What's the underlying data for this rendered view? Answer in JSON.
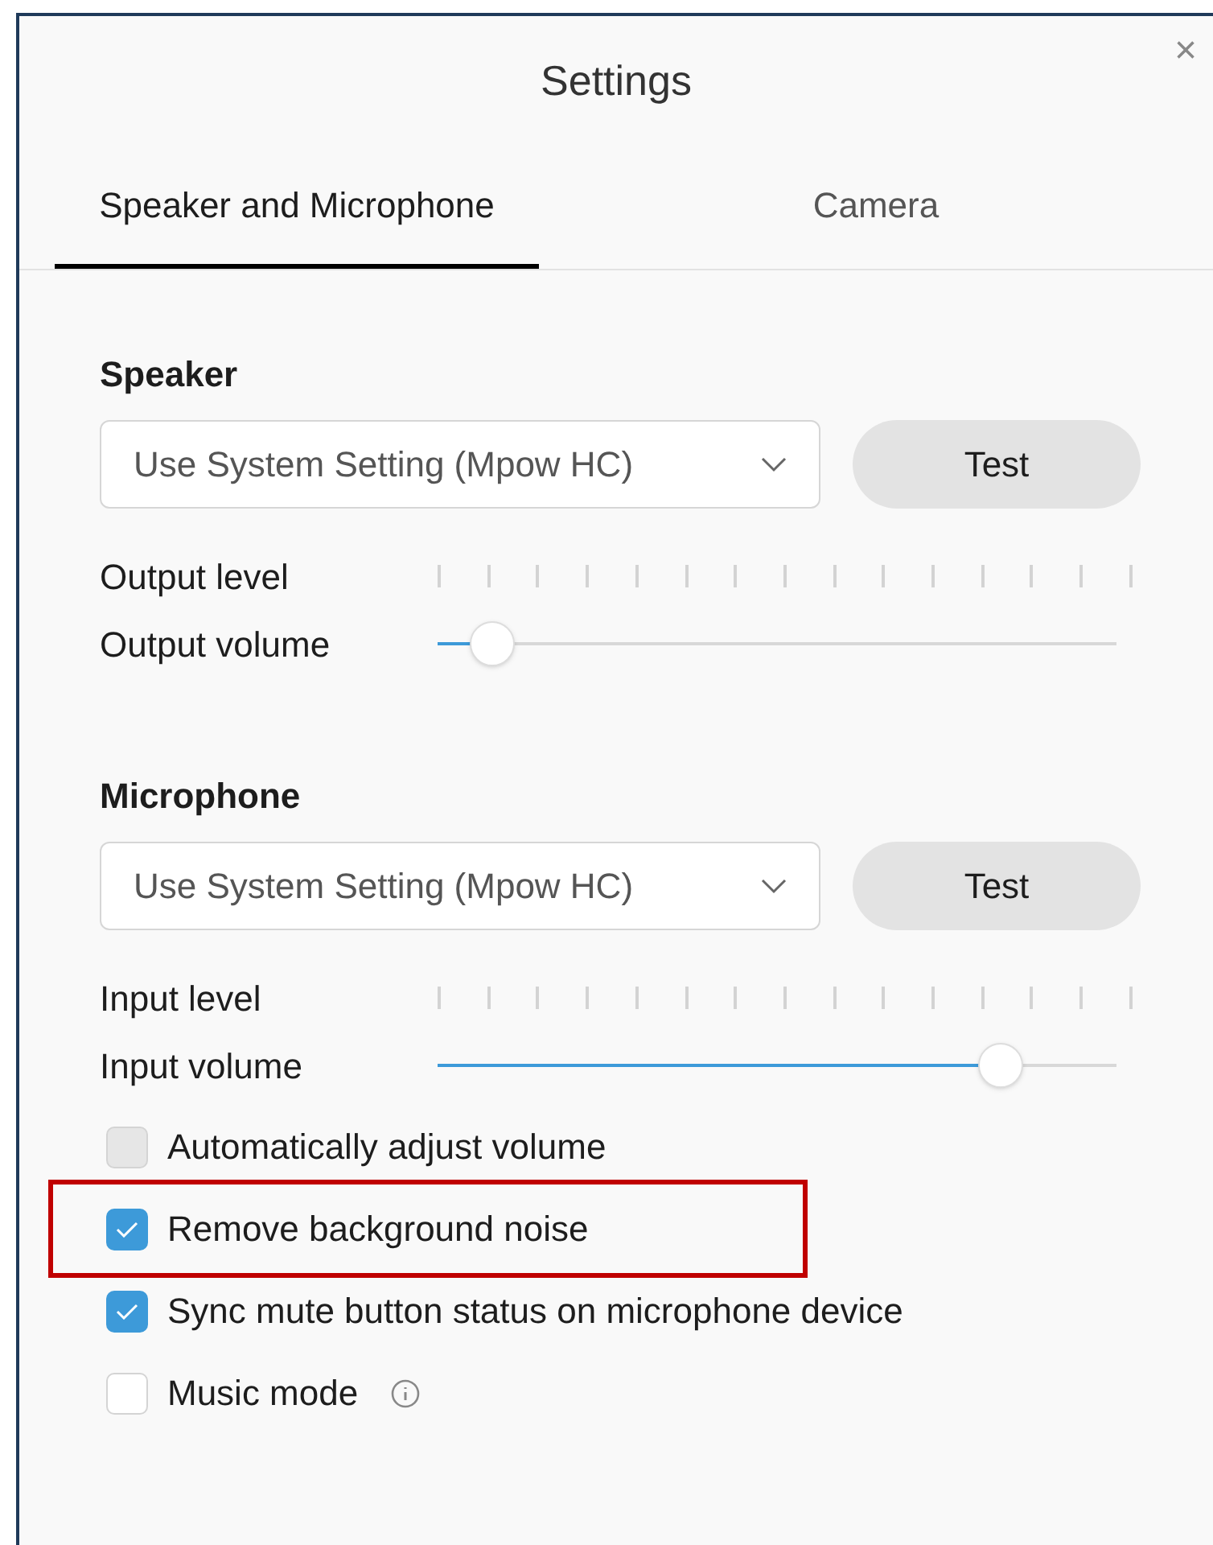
{
  "window": {
    "title": "Settings",
    "close": "×"
  },
  "tabs": [
    {
      "label": "Speaker and Microphone",
      "selected": true
    },
    {
      "label": "Camera",
      "selected": false
    }
  ],
  "sections": [
    {
      "heading": "Speaker",
      "device": {
        "value": "Use System Setting (Mpow HC)"
      },
      "test_button": "Test",
      "level_label": "Output level",
      "volume_label": "Output volume",
      "volume": {
        "level": 0.08
      }
    },
    {
      "heading": "Microphone",
      "device": {
        "value": "Use System Setting (Mpow HC)"
      },
      "test_button": "Test",
      "level_label": "Input level",
      "volume_label": "Input volume",
      "volume": {
        "level": 0.83
      }
    }
  ],
  "options": [
    {
      "label": "Automatically adjust volume",
      "checked": false,
      "disabled": true,
      "highlighted": false,
      "info": false
    },
    {
      "label": "Remove background noise",
      "checked": true,
      "disabled": false,
      "highlighted": true,
      "info": false
    },
    {
      "label": "Sync mute button status on microphone device",
      "checked": true,
      "disabled": false,
      "highlighted": false,
      "info": false
    },
    {
      "label": "Music mode",
      "checked": false,
      "disabled": false,
      "highlighted": false,
      "info": true
    }
  ]
}
